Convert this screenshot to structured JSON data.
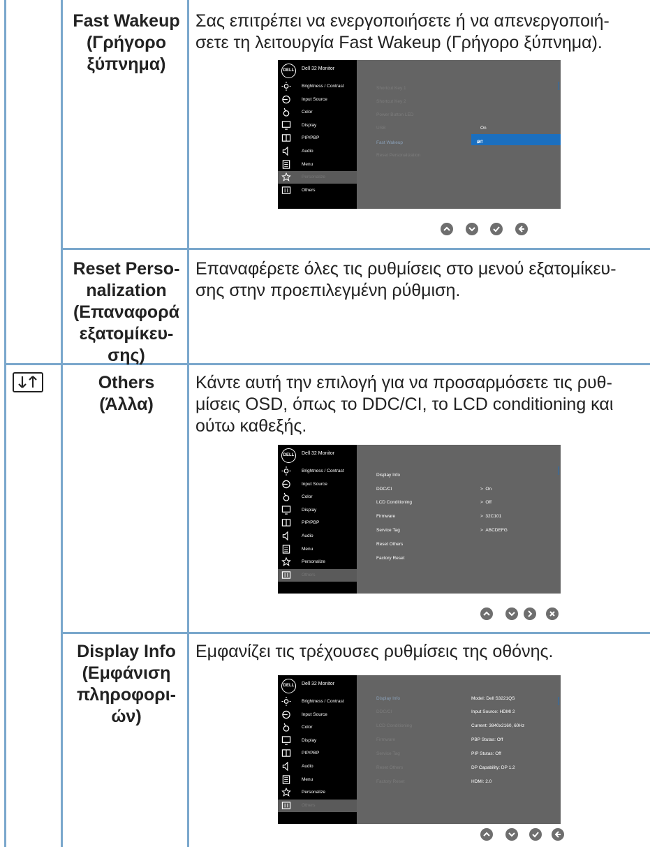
{
  "rows": [
    {
      "name": [
        "Fast Wakeup",
        "(Γρήγορο",
        "ξύπνημα)"
      ],
      "desc": [
        "Σας επιτρέπει να ενεργοποιήσετε ή να απενεργοποιή-",
        "σετε τη λειτουργία Fast Wakeup (Γρήγορο ξύπνημα)."
      ]
    },
    {
      "name": [
        "Reset Perso-",
        "nalization",
        "(Επαναφορά",
        "εξατομίκευ-",
        "σης)"
      ],
      "desc": [
        "Επαναφέρετε όλες τις ρυθμίσεις στο μενού εξατομίκευ-",
        "σης στην προεπιλεγμένη ρύθμιση."
      ]
    },
    {
      "name": [
        "Others",
        "(Άλλα)"
      ],
      "desc": [
        "Κάντε αυτή την επιλογή για να προσαρμόσετε τις ρυθ-",
        "μίσεις OSD, όπως το DDC/CI, το LCD conditioning και",
        "ούτω καθεξής."
      ]
    },
    {
      "name": [
        "Display Info",
        "(Εμφάνιση",
        "πληροφορι-",
        "ών)"
      ],
      "desc": [
        "Εμφανίζει τις τρέχουσες ρυθμίσεις της οθόνης."
      ]
    }
  ],
  "osd_common": {
    "logo": "DELL",
    "title": "Dell 32 Monitor",
    "menu": [
      "Brightness / Contrast",
      "Input Source",
      "Color",
      "Display",
      "PIP/PBP",
      "Audio",
      "Menu",
      "Personalize",
      "Others"
    ],
    "icons": [
      "brightness-icon",
      "input-source-icon",
      "color-icon",
      "display-icon",
      "pip-pbp-icon",
      "audio-icon",
      "menu-icon",
      "personalize-icon",
      "others-icon"
    ]
  },
  "osd1": {
    "selected_menu": "Personalize",
    "items": [
      "Shortcut Key 1",
      "Shortcut Key 2",
      "Power Button LED",
      "USB",
      "Fast Wakeup",
      "Reset Personalization"
    ],
    "options": [
      "On",
      "Off"
    ],
    "selected_option": "Off",
    "buttons": [
      "up-icon",
      "down-icon",
      "check-icon",
      "back-icon"
    ]
  },
  "osd2": {
    "selected_menu": "Others",
    "items": [
      "Display Info",
      "DDC/CI",
      "LCD Conditioning",
      "Firmware",
      "Service Tag",
      "Reset Others",
      "Factory Reset"
    ],
    "values": [
      "On",
      "Off",
      "32C101",
      "ABCDEFG"
    ],
    "buttons": [
      "up-icon",
      "down-icon",
      "right-icon",
      "close-icon"
    ]
  },
  "osd3": {
    "selected_menu": "Others",
    "items": [
      "Display Info",
      "DDC/CI",
      "LCD Conditioning",
      "Firmware",
      "Service Tag",
      "Reset Others",
      "Factory Reset"
    ],
    "info": [
      "Model: Dell S3221QS",
      "Input Source: HDMI 2",
      "Current: 3840x2160, 60Hz",
      "PBP Stutas: Off",
      "PIP Stutas: Off",
      "DP Capability: DP 1.2",
      "HDMI: 2.0"
    ],
    "buttons": [
      "up-icon",
      "down-icon",
      "check-icon",
      "back-icon"
    ]
  },
  "colors": {
    "border": "#7aa7cc",
    "osd_bg": "#646464",
    "osd_sidebar": "#000000",
    "highlight": "#1b6fbf"
  }
}
